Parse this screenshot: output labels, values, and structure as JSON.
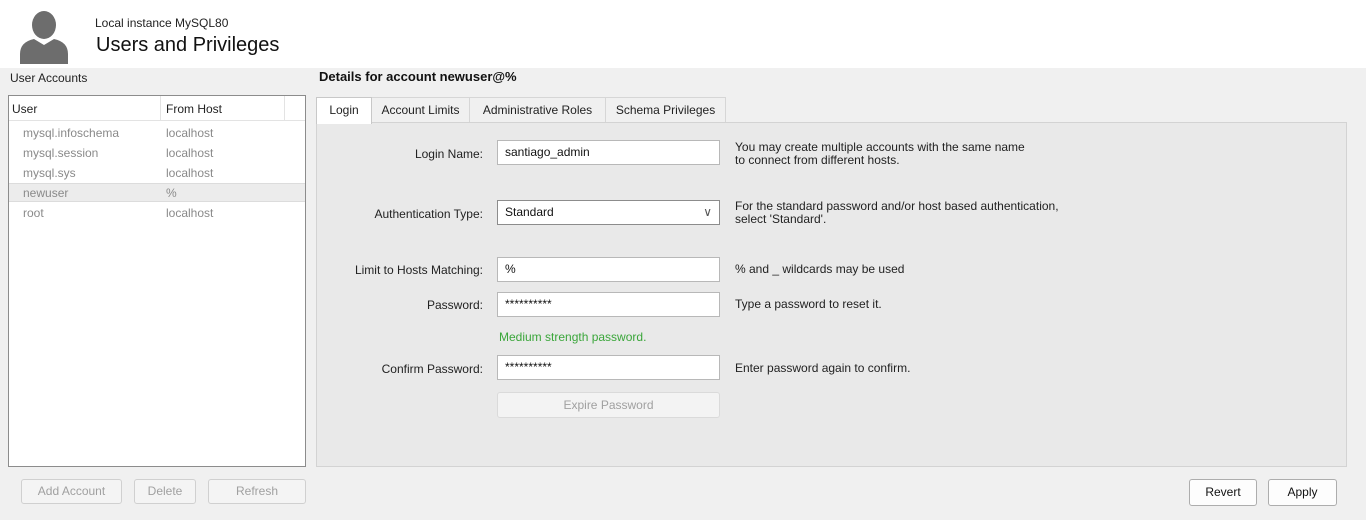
{
  "header": {
    "instance": "Local instance MySQL80",
    "title": "Users and Privileges",
    "avatar_icon": "user-silhouette-icon"
  },
  "accounts": {
    "section_title": "User Accounts",
    "columns": [
      "User",
      "From Host"
    ],
    "rows": [
      {
        "user": "mysql.infoschema",
        "host": "localhost"
      },
      {
        "user": "mysql.session",
        "host": "localhost"
      },
      {
        "user": "mysql.sys",
        "host": "localhost"
      },
      {
        "user": "newuser",
        "host": "%"
      },
      {
        "user": "root",
        "host": "localhost"
      }
    ],
    "buttons": {
      "add": "Add Account",
      "delete": "Delete",
      "refresh": "Refresh"
    }
  },
  "details": {
    "title": "Details for account newuser@%",
    "tabs": [
      "Login",
      "Account Limits",
      "Administrative Roles",
      "Schema Privileges"
    ],
    "login_name": {
      "label": "Login Name:",
      "value": "santiago_admin",
      "help": "You may create multiple accounts with the same name",
      "help2": "to connect from different hosts."
    },
    "auth_type": {
      "label": "Authentication Type:",
      "value": "Standard",
      "help": "For the standard password and/or host based authentication,",
      "help2": "select 'Standard'."
    },
    "hosts": {
      "label": "Limit to Hosts Matching:",
      "value": "%",
      "help": "% and _ wildcards may be used"
    },
    "password": {
      "label": "Password:",
      "value": "**********",
      "help": "Type a password to reset it."
    },
    "strength": "Medium strength password.",
    "confirm": {
      "label": "Confirm Password:",
      "value": "**********",
      "help": "Enter password again to confirm."
    },
    "expire_button": "Expire Password"
  },
  "footer": {
    "revert": "Revert",
    "apply": "Apply"
  },
  "colors": {
    "strength": "#3aa63a",
    "panel": "#e9e9e9"
  }
}
